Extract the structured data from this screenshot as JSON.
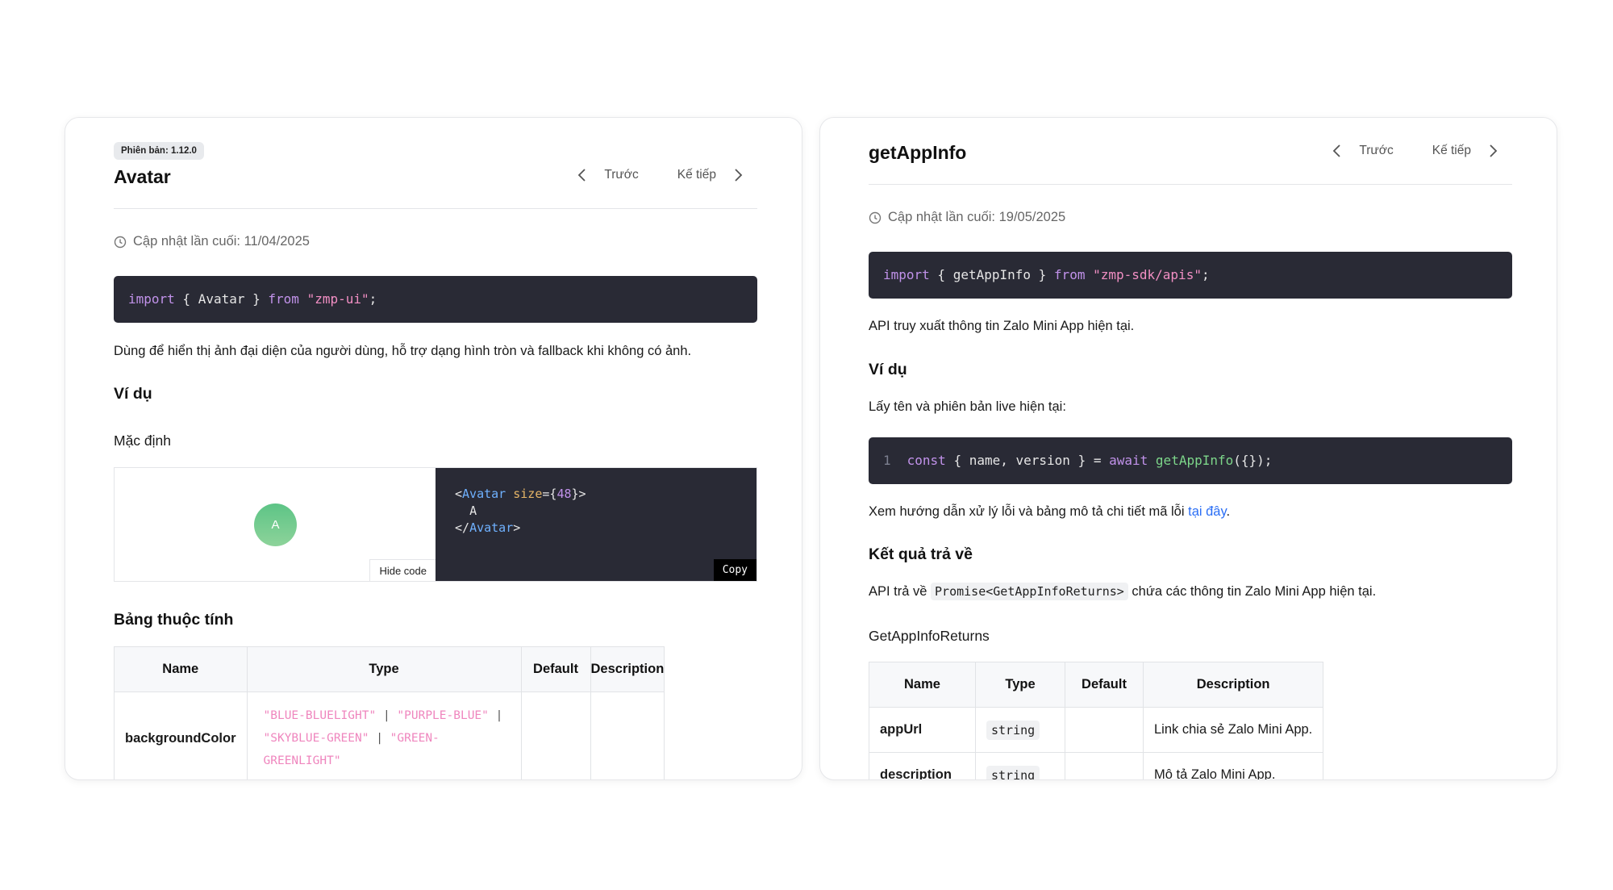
{
  "left": {
    "version_badge": "Phiên bản: 1.12.0",
    "title": "Avatar",
    "nav": {
      "prev": "Trước",
      "next": "Kế tiếp"
    },
    "last_updated": "Cập nhật lần cuối: 11/04/2025",
    "import_code": {
      "kw1": "import",
      "body": " { Avatar } ",
      "kw2": "from",
      "module": "\"zmp-ui\"",
      "end": ";"
    },
    "description": "Dùng để hiển thị ảnh đại diện của người dùng, hỗ trợ dạng hình tròn và fallback khi không có ảnh.",
    "example_heading": "Ví dụ",
    "default_heading": "Mặc định",
    "demo": {
      "avatar_letter": "A",
      "hide_code": "Hide code",
      "copy": "Copy",
      "code": {
        "tag": "Avatar",
        "attr": "size",
        "value": "48",
        "child": "A"
      }
    },
    "props_heading": "Bảng thuộc tính",
    "table": {
      "headers": [
        "Name",
        "Type",
        "Default",
        "Description"
      ],
      "rows": [
        {
          "name": "backgroundColor",
          "type_values": [
            "\"BLUE-BLUELIGHT\"",
            "\"PURPLE-BLUE\"",
            "\"SKYBLUE-GREEN\"",
            "\"GREEN-GREENLIGHT\""
          ],
          "default": "",
          "description": ""
        }
      ]
    }
  },
  "right": {
    "title": "getAppInfo",
    "nav": {
      "prev": "Trước",
      "next": "Kế tiếp"
    },
    "last_updated": "Cập nhật lần cuối: 19/05/2025",
    "import_code": {
      "kw1": "import",
      "body": " { getAppInfo } ",
      "kw2": "from",
      "module": "\"zmp-sdk/apis\"",
      "end": ";"
    },
    "description": "API truy xuất thông tin Zalo Mini App hiện tại.",
    "example_heading": "Ví dụ",
    "example_desc": "Lấy tên và phiên bản live hiện tại:",
    "example_code": {
      "line_no": "1",
      "kw1": "const",
      "mid": " { name, version } = ",
      "kw2": "await",
      "fn": "getAppInfo",
      "end": "({});"
    },
    "error_note": "Xem hướng dẫn xử lý lỗi và bảng mô tả chi tiết mã lỗi ",
    "error_link": "tại đây",
    "error_end": ".",
    "returns_heading": "Kết quả trả về",
    "returns_desc_pre": "API trả về ",
    "returns_type": "Promise<GetAppInfoReturns>",
    "returns_desc_post": " chứa các thông tin Zalo Mini App hiện tại.",
    "returns_type_heading": "GetAppInfoReturns",
    "table": {
      "headers": [
        "Name",
        "Type",
        "Default",
        "Description"
      ],
      "rows": [
        {
          "name": "appUrl",
          "type": "string",
          "default": "",
          "description": "Link chia sẻ Zalo Mini App."
        },
        {
          "name": "description",
          "type": "string",
          "default": "",
          "description": "Mô tả Zalo Mini App."
        }
      ]
    }
  },
  "colors": {
    "code_bg": "#292a35",
    "keyword": "#c192ea",
    "string": "#f28fc4",
    "function": "#7dd68a",
    "link": "#2a6ef5"
  },
  "icons": [
    "chevron-left-icon",
    "chevron-right-icon",
    "clock-icon"
  ]
}
